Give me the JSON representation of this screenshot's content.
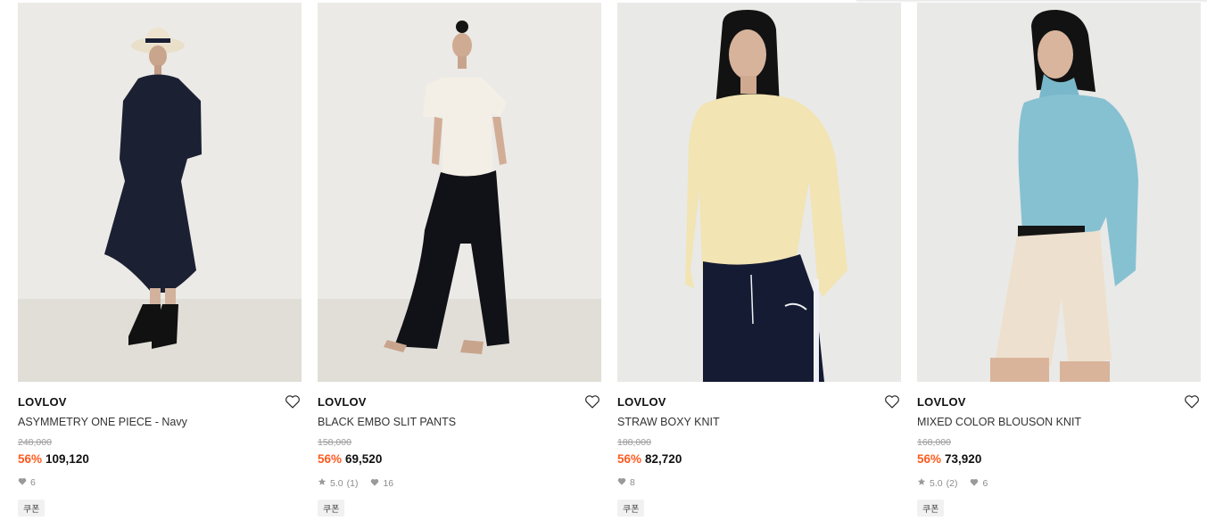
{
  "products": [
    {
      "brand": "LOVLOV",
      "name": "ASYMMETRY ONE PIECE - Navy",
      "original_price": "248,000",
      "discount": "56%",
      "price": "109,120",
      "rating": null,
      "rating_count": null,
      "likes": "6",
      "coupon": "쿠폰"
    },
    {
      "brand": "LOVLOV",
      "name": "BLACK EMBO SLIT PANTS",
      "original_price": "158,000",
      "discount": "56%",
      "price": "69,520",
      "rating": "5.0",
      "rating_count": "(1)",
      "likes": "16",
      "coupon": "쿠폰"
    },
    {
      "brand": "LOVLOV",
      "name": "STRAW BOXY KNIT",
      "original_price": "188,000",
      "discount": "56%",
      "price": "82,720",
      "rating": null,
      "rating_count": null,
      "likes": "8",
      "coupon": "쿠폰"
    },
    {
      "brand": "LOVLOV",
      "name": "MIXED COLOR BLOUSON KNIT",
      "original_price": "168,000",
      "discount": "56%",
      "price": "73,920",
      "rating": "5.0",
      "rating_count": "(2)",
      "likes": "6",
      "coupon": "쿠폰"
    }
  ],
  "icons": {
    "wishlist": "heart-outline-icon",
    "likes": "heart-filled-icon",
    "rating": "star-icon"
  },
  "colors": {
    "discount": "#ff5a1f",
    "price": "#111111",
    "original_price": "#9a9a9a",
    "meta": "#8c8c8c",
    "coupon_bg": "#f1f1f1"
  }
}
